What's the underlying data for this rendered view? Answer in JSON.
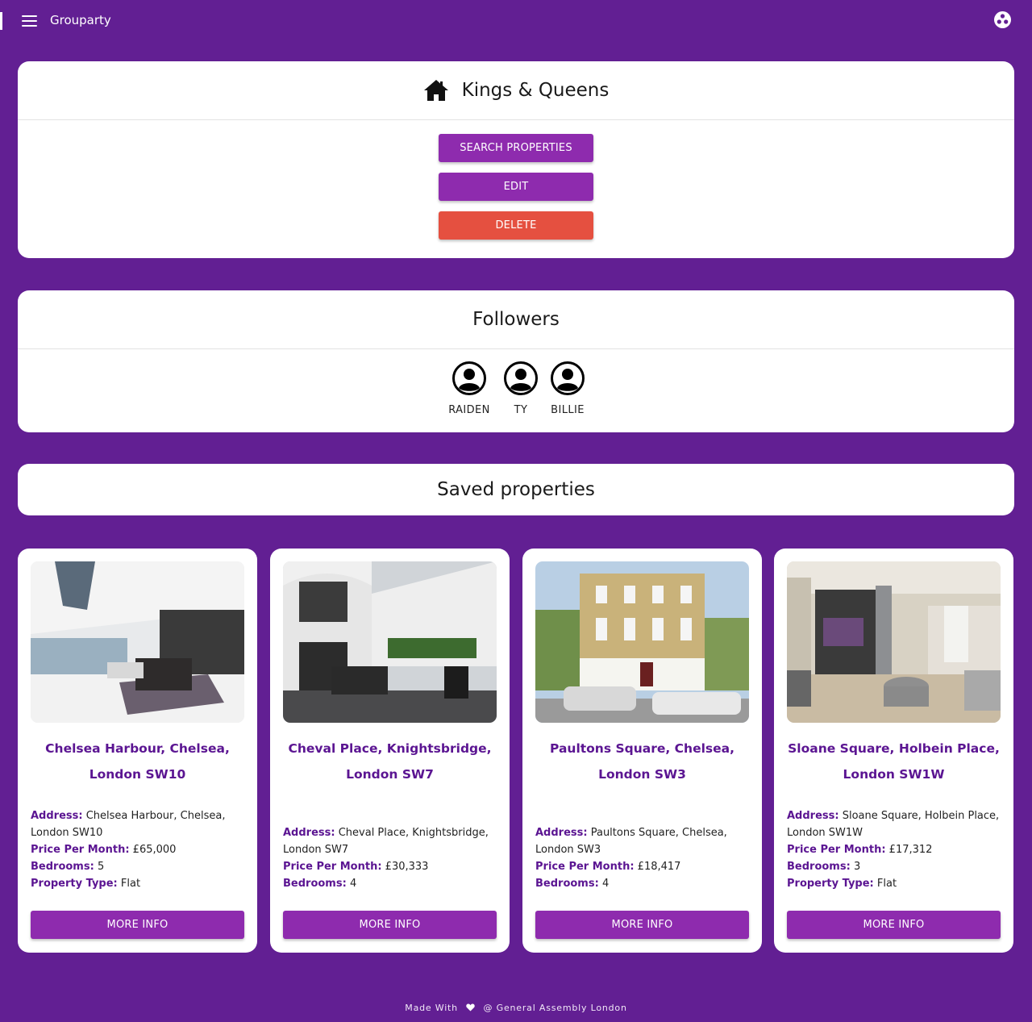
{
  "navbar": {
    "app_title": "Grouparty",
    "menu_icon": "hamburger-icon",
    "account_icon": "account-dots-icon"
  },
  "group": {
    "icon": "home-icon",
    "title": "Kings & Queens",
    "buttons": {
      "search": "SEARCH PROPERTIES",
      "edit": "EDIT",
      "delete": "DELETE"
    }
  },
  "followers": {
    "title": "Followers",
    "items": [
      {
        "name": "RAIDEN",
        "icon": "user-avatar-icon"
      },
      {
        "name": "TY",
        "icon": "user-avatar-icon"
      },
      {
        "name": "BILLIE",
        "icon": "user-avatar-icon"
      }
    ]
  },
  "saved": {
    "title": "Saved properties",
    "labels": {
      "address": "Address:",
      "price": "Price Per Month:",
      "bedrooms": "Bedrooms:",
      "type": "Property Type:"
    },
    "properties": [
      {
        "title_line1": "Chelsea Harbour, Chelsea,",
        "title_line2": "London SW10",
        "address": "Chelsea Harbour, Chelsea, London SW10",
        "price": "£65,000",
        "bedrooms": "5",
        "type": "Flat",
        "button": "MORE INFO"
      },
      {
        "title_line1": "Cheval Place, Knightsbridge,",
        "title_line2": "London SW7",
        "address": "Cheval Place, Knightsbridge, London SW7",
        "price": "£30,333",
        "bedrooms": "4",
        "button": "MORE INFO"
      },
      {
        "title_line1": "Paultons Square, Chelsea,",
        "title_line2": "London SW3",
        "address": "Paultons Square, Chelsea, London SW3",
        "price": "£18,417",
        "bedrooms": "4",
        "button": "MORE INFO"
      },
      {
        "title_line1": "Sloane Square, Holbein Place,",
        "title_line2": "London SW1W",
        "address": "Sloane Square, Holbein Place, London SW1W",
        "price": "£17,312",
        "bedrooms": "3",
        "type": "Flat",
        "button": "MORE INFO"
      }
    ]
  },
  "footer": {
    "made_with": "Made With",
    "credit": "@ General Assembly London",
    "icon": "heart-icon"
  },
  "colors": {
    "background": "#621f93",
    "primary_button": "#8e2bae",
    "delete_button": "#e55040",
    "title_text": "#5b1592"
  }
}
